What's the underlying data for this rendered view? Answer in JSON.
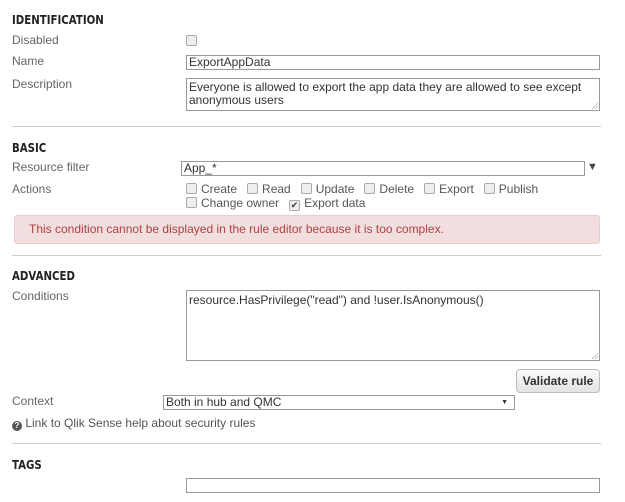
{
  "identification": {
    "heading": "IDENTIFICATION",
    "disabled_label": "Disabled",
    "disabled_checked": false,
    "name_label": "Name",
    "name_value": "ExportAppData",
    "description_label": "Description",
    "description_value": "Everyone is allowed to export the app data they are allowed to see except anonymous users"
  },
  "basic": {
    "heading": "BASIC",
    "resource_filter_label": "Resource filter",
    "resource_filter_value": "App_*",
    "actions_label": "Actions",
    "actions": [
      {
        "label": "Create",
        "checked": false
      },
      {
        "label": "Read",
        "checked": false
      },
      {
        "label": "Update",
        "checked": false
      },
      {
        "label": "Delete",
        "checked": false
      },
      {
        "label": "Export",
        "checked": false
      },
      {
        "label": "Publish",
        "checked": false
      },
      {
        "label": "Change owner",
        "checked": false
      },
      {
        "label": "Export data",
        "checked": true
      }
    ],
    "alert": "This condition cannot be displayed in the rule editor because it is too complex."
  },
  "advanced": {
    "heading": "ADVANCED",
    "conditions_label": "Conditions",
    "conditions_value": "resource.HasPrivilege(\"read\") and !user.IsAnonymous()",
    "validate_button": "Validate rule",
    "context_label": "Context",
    "context_value": "Both in hub and QMC",
    "help_link": "Link to Qlik Sense help about security rules"
  },
  "tags": {
    "heading": "TAGS",
    "value": ""
  }
}
